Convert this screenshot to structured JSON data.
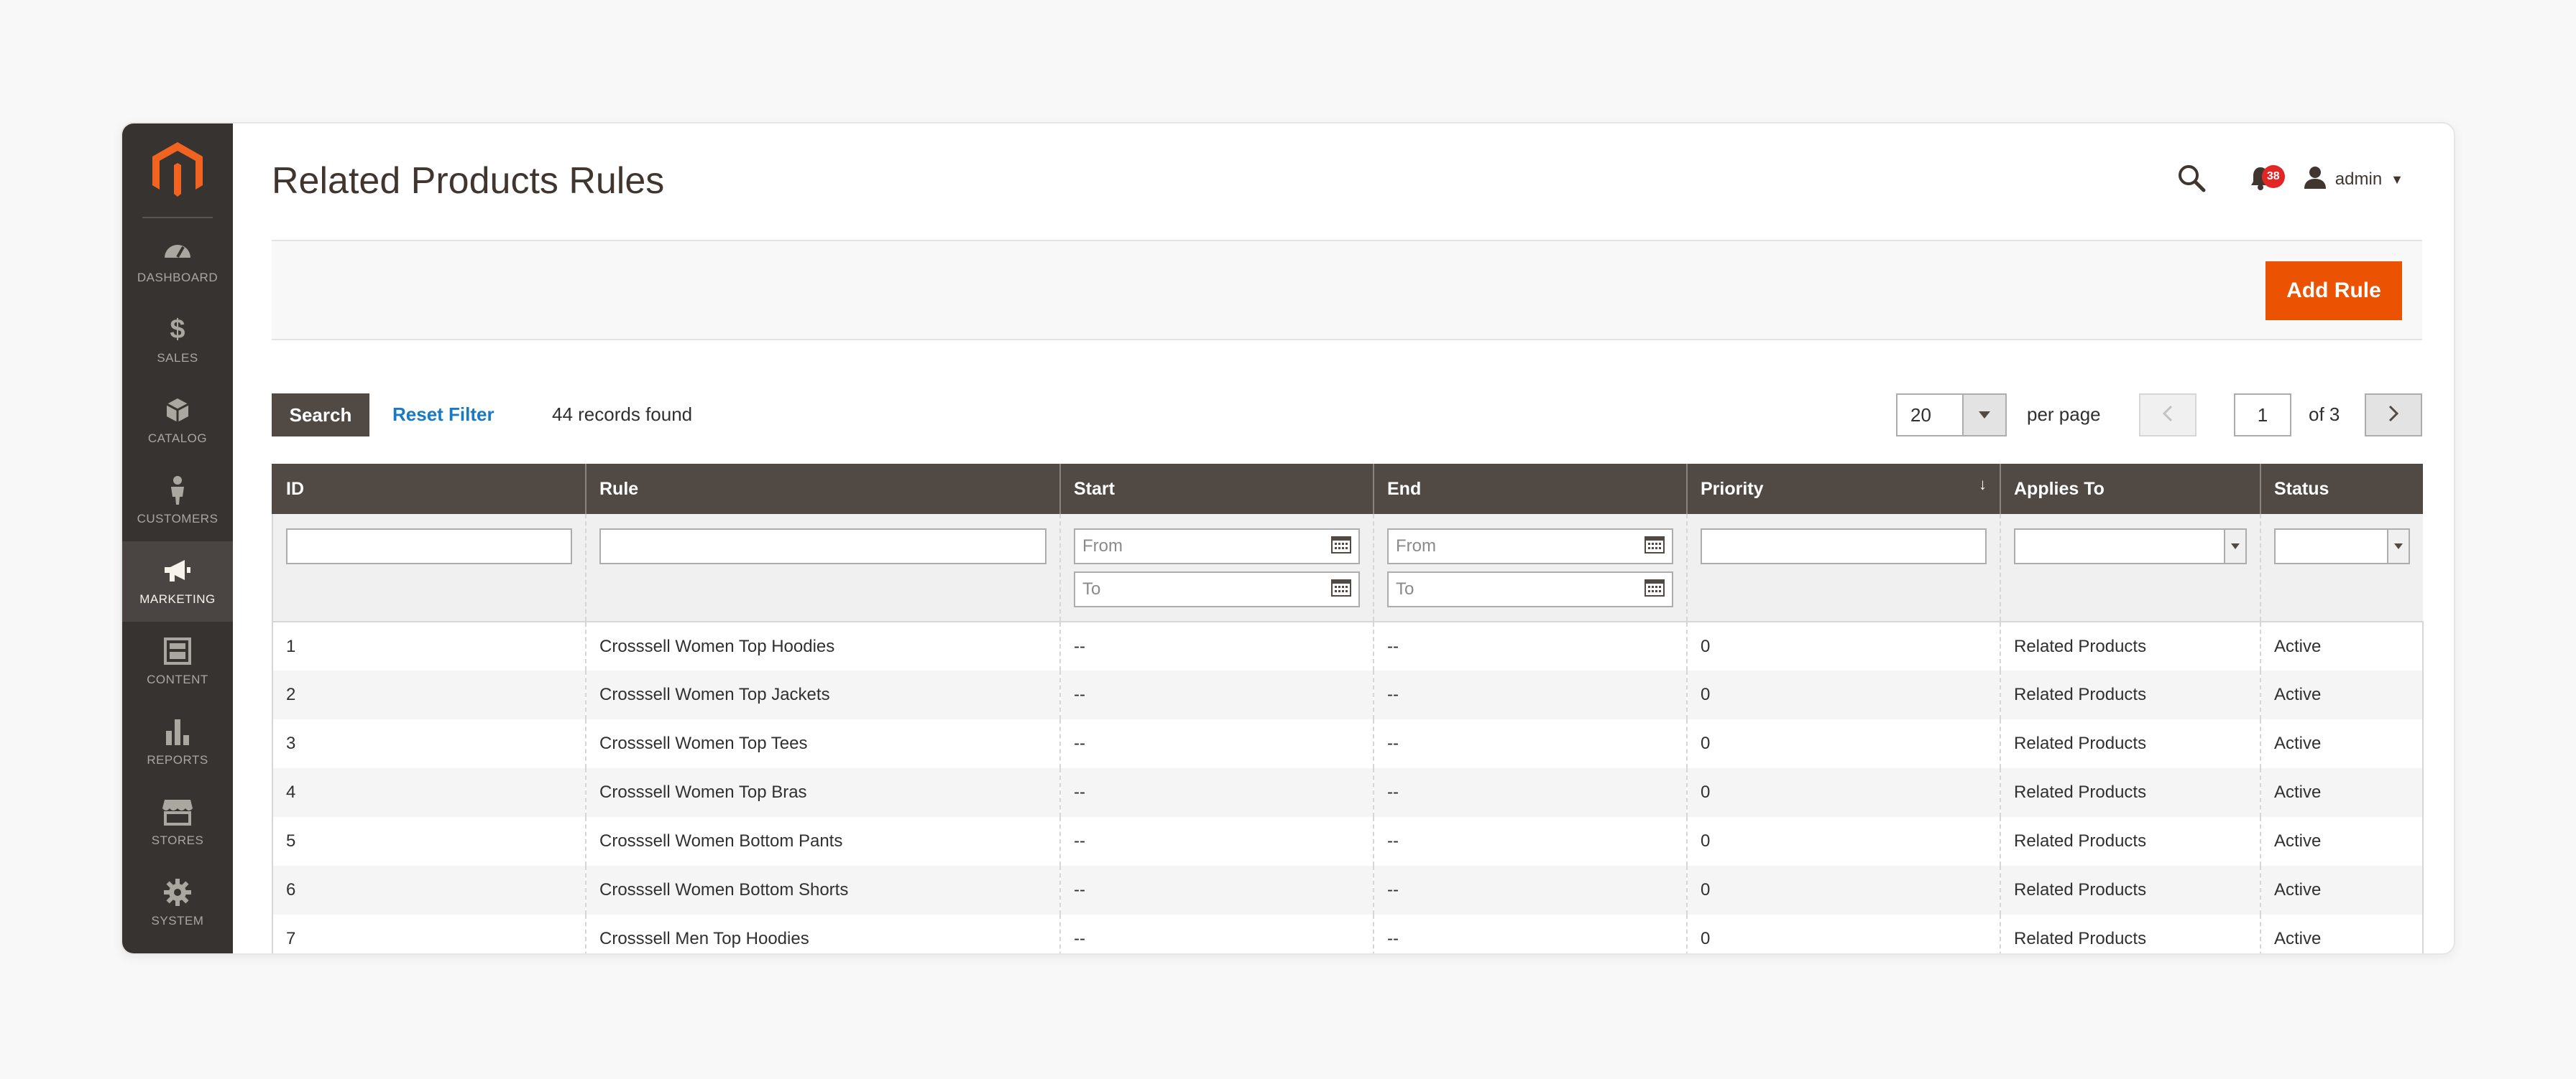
{
  "page": {
    "title": "Related Products Rules"
  },
  "sidebar": {
    "items": [
      {
        "label": "DASHBOARD",
        "icon": "dashboard-icon"
      },
      {
        "label": "SALES",
        "icon": "dollar-icon"
      },
      {
        "label": "CATALOG",
        "icon": "box-icon"
      },
      {
        "label": "CUSTOMERS",
        "icon": "person-icon"
      },
      {
        "label": "MARKETING",
        "icon": "megaphone-icon",
        "active": true
      },
      {
        "label": "CONTENT",
        "icon": "layout-icon"
      },
      {
        "label": "REPORTS",
        "icon": "bar-chart-icon"
      },
      {
        "label": "STORES",
        "icon": "storefront-icon"
      },
      {
        "label": "SYSTEM",
        "icon": "gear-icon"
      }
    ]
  },
  "header": {
    "notifications_count": "38",
    "user_name": "admin"
  },
  "actions": {
    "add_rule_label": "Add Rule"
  },
  "toolbar": {
    "search_label": "Search",
    "reset_label": "Reset Filter",
    "records_text": "44 records found",
    "per_page_value": "20",
    "per_page_label": "per page",
    "page_value": "1",
    "page_of": "of 3"
  },
  "grid": {
    "columns": [
      "ID",
      "Rule",
      "Start",
      "End",
      "Priority",
      "Applies To",
      "Status"
    ],
    "filters": {
      "from": "From",
      "to": "To"
    },
    "rows": [
      [
        "1",
        "Crosssell Women Top Hoodies",
        "--",
        "--",
        "0",
        "Related Products",
        "Active"
      ],
      [
        "2",
        "Crosssell Women Top Jackets",
        "--",
        "--",
        "0",
        "Related Products",
        "Active"
      ],
      [
        "3",
        "Crosssell Women Top Tees",
        "--",
        "--",
        "0",
        "Related Products",
        "Active"
      ],
      [
        "4",
        "Crosssell Women Top Bras",
        "--",
        "--",
        "0",
        "Related Products",
        "Active"
      ],
      [
        "5",
        "Crosssell Women Bottom Pants",
        "--",
        "--",
        "0",
        "Related Products",
        "Active"
      ],
      [
        "6",
        "Crosssell Women Bottom Shorts",
        "--",
        "--",
        "0",
        "Related Products",
        "Active"
      ],
      [
        "7",
        "Crosssell Men Top Hoodies",
        "--",
        "--",
        "0",
        "Related Products",
        "Active"
      ]
    ]
  },
  "colors": {
    "accent": "#eb5202",
    "sidebar": "#373330",
    "header": "#514943",
    "link": "#1979c3",
    "badge": "#e22626"
  }
}
